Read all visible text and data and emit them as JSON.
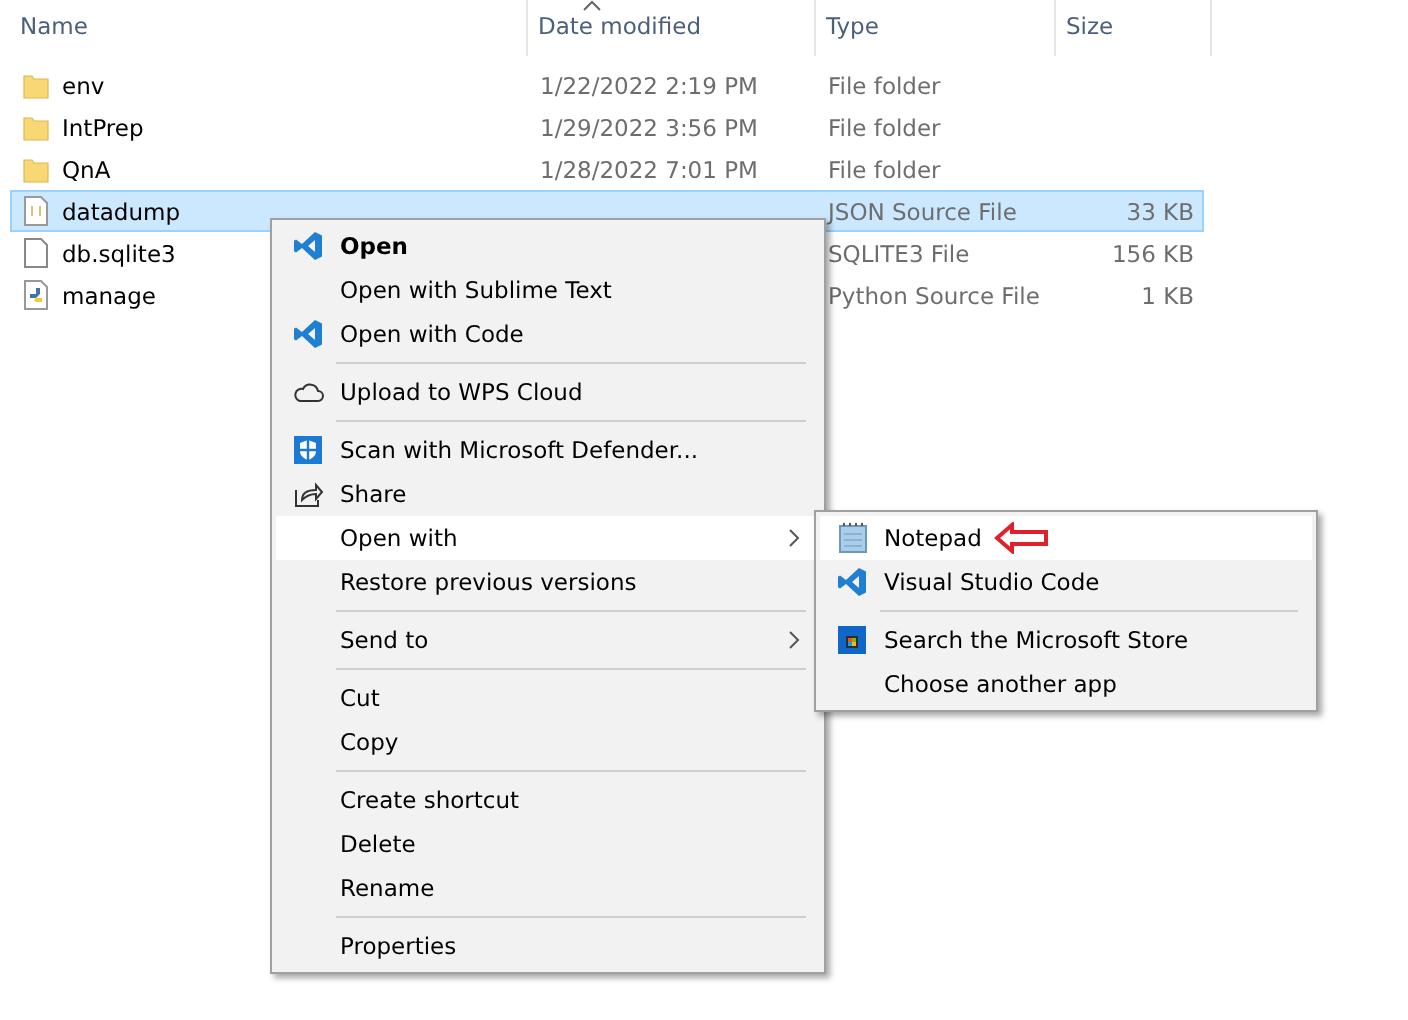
{
  "columns": [
    {
      "label": "Name"
    },
    {
      "label": "Date modified"
    },
    {
      "label": "Type"
    },
    {
      "label": "Size"
    }
  ],
  "files": [
    {
      "kind": "folder",
      "name": "env",
      "date": "1/22/2022 2:19 PM",
      "type": "File folder",
      "selected": false
    },
    {
      "kind": "folder",
      "name": "IntPrep",
      "date": "1/29/2022 3:56 PM",
      "type": "File folder",
      "selected": false
    },
    {
      "kind": "folder",
      "name": "QnA",
      "date": "1/28/2022 7:01 PM",
      "type": "File folder",
      "selected": false
    },
    {
      "kind": "json",
      "name": "datadump",
      "type": "JSON Source File",
      "size": "33 KB",
      "selected": true
    },
    {
      "kind": "file",
      "name": "db.sqlite3",
      "type": "SQLITE3 File",
      "size": "156 KB",
      "selected": false
    },
    {
      "kind": "python",
      "name": "manage",
      "type": "Python Source File",
      "size": "1 KB",
      "selected": false
    }
  ],
  "context_menu": [
    {
      "kind": "vscode",
      "label": "Open",
      "default": true,
      "selected": false
    },
    {
      "kind": "plain",
      "label": "Open with Sublime Text",
      "default": false,
      "selected": false
    },
    {
      "kind": "vscode",
      "label": "Open with Code",
      "default": false,
      "selected": false
    },
    {
      "kind": "separator"
    },
    {
      "kind": "cloud",
      "label": "Upload to WPS Cloud",
      "default": false,
      "selected": false
    },
    {
      "kind": "separator"
    },
    {
      "kind": "shield",
      "label": "Scan with Microsoft Defender...",
      "default": false,
      "selected": false
    },
    {
      "kind": "share",
      "label": "Share",
      "default": false,
      "selected": false
    },
    {
      "kind": "submenu",
      "label": "Open with",
      "default": false,
      "selected": true
    },
    {
      "kind": "plain",
      "label": "Restore previous versions",
      "default": false,
      "selected": false
    },
    {
      "kind": "separator"
    },
    {
      "kind": "submenu",
      "label": "Send to",
      "default": false,
      "selected": false
    },
    {
      "kind": "separator"
    },
    {
      "kind": "plain",
      "label": "Cut",
      "default": false,
      "selected": false
    },
    {
      "kind": "plain",
      "label": "Copy",
      "default": false,
      "selected": false
    },
    {
      "kind": "separator"
    },
    {
      "kind": "plain",
      "label": "Create shortcut",
      "default": false,
      "selected": false
    },
    {
      "kind": "plain",
      "label": "Delete",
      "default": false,
      "selected": false
    },
    {
      "kind": "plain",
      "label": "Rename",
      "default": false,
      "selected": false
    },
    {
      "kind": "separator"
    },
    {
      "kind": "plain",
      "label": "Properties",
      "default": false,
      "selected": false
    }
  ],
  "open_with_menu": [
    {
      "kind": "notepad",
      "label": "Notepad",
      "default": false,
      "selected": true,
      "annotated": true
    },
    {
      "kind": "vscode",
      "label": "Visual Studio Code",
      "default": false,
      "selected": false,
      "annotated": false
    },
    {
      "kind": "separator"
    },
    {
      "kind": "store",
      "label": "Search the Microsoft Store",
      "default": false,
      "selected": false,
      "annotated": false
    },
    {
      "kind": "plain",
      "label": "Choose another app",
      "default": false,
      "selected": false,
      "annotated": false
    }
  ]
}
